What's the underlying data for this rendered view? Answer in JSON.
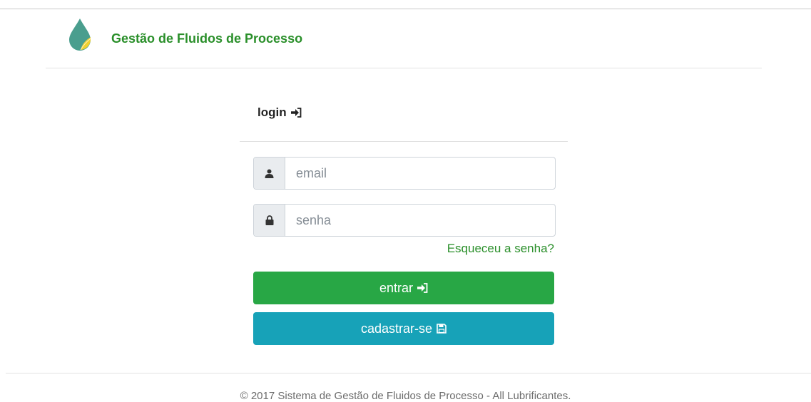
{
  "header": {
    "logo_icon": "drop-leaf-logo",
    "title": "Gestão de Fluidos de Processo"
  },
  "login": {
    "title": "login",
    "title_icon": "sign-in-icon",
    "email": {
      "placeholder": "email",
      "value": "",
      "icon": "user-icon"
    },
    "password": {
      "placeholder": "senha",
      "value": "",
      "icon": "lock-icon"
    },
    "forgot_link": "Esqueceu a senha?",
    "submit_label": "entrar",
    "submit_icon": "sign-in-icon",
    "register_label": "cadastrar-se",
    "register_icon": "save-icon"
  },
  "footer": {
    "copyright": "© 2017 Sistema de Gestão de Fluidos de Processo - All Lubrificantes."
  },
  "colors": {
    "brand_green": "#2a8f2a",
    "button_green": "#28a745",
    "button_teal": "#17a2b8",
    "logo_teal": "#4a9e8e",
    "logo_yellow": "#f2d02e"
  }
}
